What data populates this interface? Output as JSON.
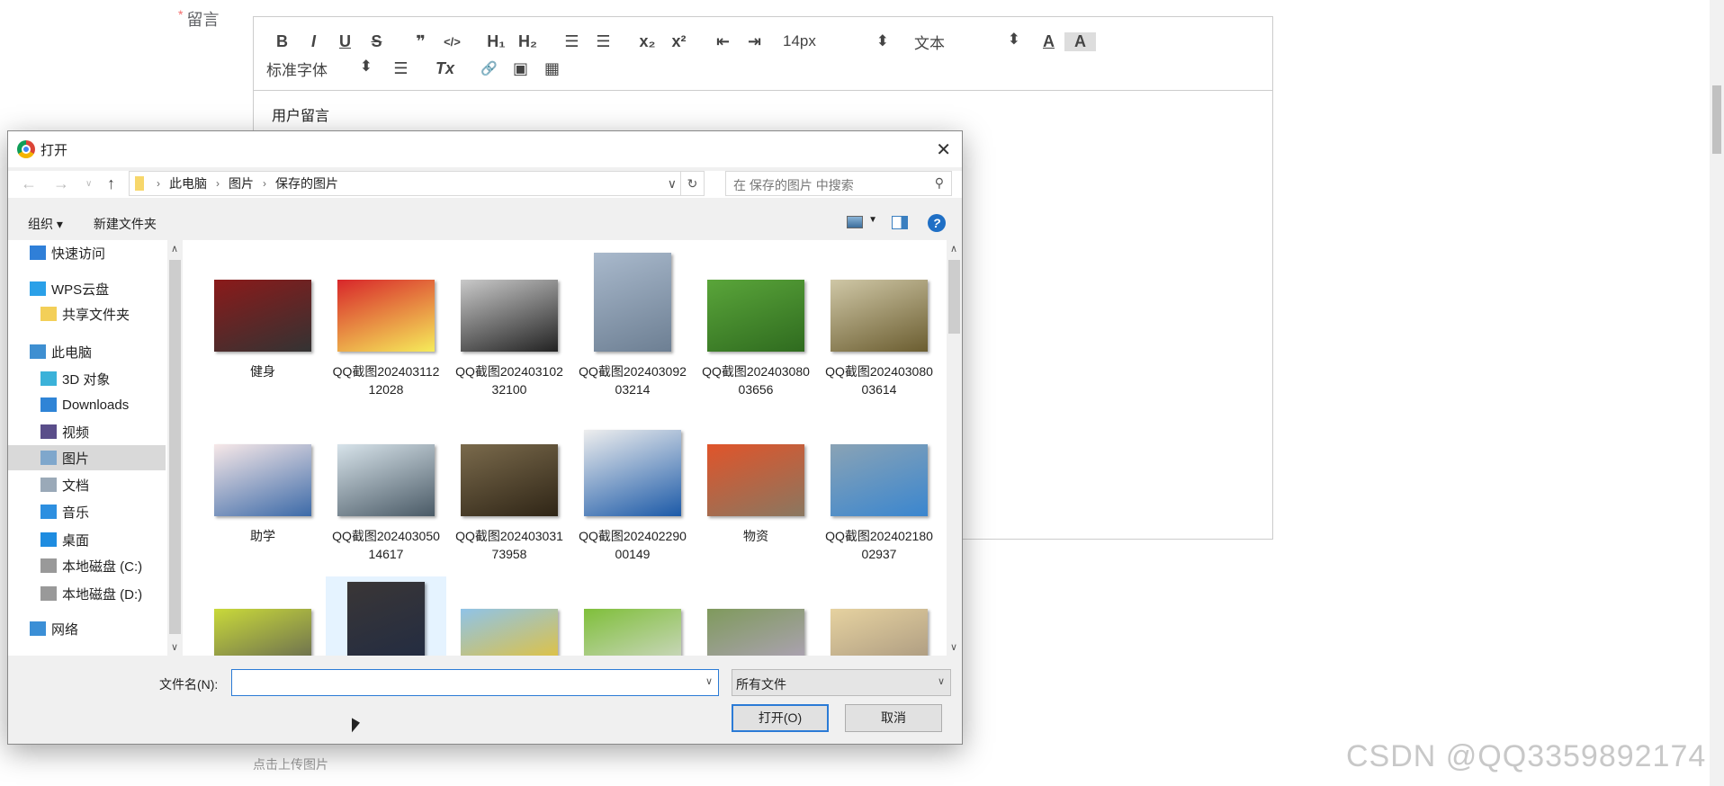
{
  "form": {
    "required_mark": "*",
    "field_label": "留言",
    "upload_hint": "点击上传图片"
  },
  "editor": {
    "toolbar": {
      "bold": "B",
      "italic": "I",
      "underline": "U",
      "strike": "S",
      "quote": "❞",
      "code": "</>",
      "h1": "H₁",
      "h2": "H₂",
      "ordered_list": "☰",
      "bullet_list": "☰",
      "subscript": "x₂",
      "superscript": "x²",
      "outdent": "⇤",
      "indent": "⇥",
      "font_size": "14px",
      "paragraph": "文本",
      "font_color": "A",
      "background": "A",
      "font_family": "标准字体",
      "align": "☰",
      "clean": "Tx",
      "link": "🔗",
      "image": "▣",
      "video": "▦"
    },
    "content": "用户留言"
  },
  "watermark": "CSDN @QQ3359892174",
  "dialog": {
    "title": "打开",
    "close": "✕",
    "breadcrumb": [
      "此电脑",
      "图片",
      "保存的图片"
    ],
    "search_placeholder": "在 保存的图片 中搜索",
    "organize": "组织 ▾",
    "new_folder": "新建文件夹",
    "help": "?",
    "nav": [
      {
        "label": "快速访问",
        "icon": "star-icon",
        "color": "#2f7fd8"
      },
      {
        "label": "WPS云盘",
        "icon": "cloud-icon",
        "color": "#2aa0e8"
      },
      {
        "label": "共享文件夹",
        "icon": "shared-folder-icon",
        "color": "#f3cf58"
      },
      {
        "label": "此电脑",
        "icon": "computer-icon",
        "color": "#3e8fd1"
      },
      {
        "label": "3D 对象",
        "icon": "cube-icon",
        "color": "#3bb2d9"
      },
      {
        "label": "Downloads",
        "icon": "download-arrow-icon",
        "color": "#2f84d6"
      },
      {
        "label": "视频",
        "icon": "film-icon",
        "color": "#5a4e8a"
      },
      {
        "label": "图片",
        "icon": "picture-icon",
        "color": "#7fa7cc",
        "selected": true
      },
      {
        "label": "文档",
        "icon": "document-icon",
        "color": "#9aa9b8"
      },
      {
        "label": "音乐",
        "icon": "music-note-icon",
        "color": "#2d8fe0"
      },
      {
        "label": "桌面",
        "icon": "desktop-icon",
        "color": "#1e8ce0"
      },
      {
        "label": "本地磁盘 (C:)",
        "icon": "drive-icon",
        "color": "#999"
      },
      {
        "label": "本地磁盘 (D:)",
        "icon": "drive-icon",
        "color": "#999"
      },
      {
        "label": "网络",
        "icon": "network-icon",
        "color": "#3b8fd6"
      }
    ],
    "files": [
      {
        "label": "健身",
        "thumb": [
          "#8b1a1a",
          "#333"
        ],
        "orientation": "landscape"
      },
      {
        "label": "QQ截图20240311212028",
        "thumb": [
          "#d8262a",
          "#f6ec5a"
        ],
        "orientation": "landscape"
      },
      {
        "label": "QQ截图20240310232100",
        "thumb": [
          "#c9c9c9",
          "#222"
        ],
        "orientation": "landscape"
      },
      {
        "label": "QQ截图20240309203214",
        "thumb": [
          "#a9b9cc",
          "#6d7f93"
        ],
        "orientation": "portrait"
      },
      {
        "label": "QQ截图20240308003656",
        "thumb": [
          "#5aa53a",
          "#2f6b1f"
        ],
        "orientation": "landscape"
      },
      {
        "label": "QQ截图20240308003614",
        "thumb": [
          "#cfc7a6",
          "#6b5d30"
        ],
        "orientation": "landscape"
      },
      {
        "label": "助学",
        "thumb": [
          "#f7e8e8",
          "#3c6aa8"
        ],
        "orientation": "landscape"
      },
      {
        "label": "QQ截图20240305014617",
        "thumb": [
          "#d7e3ea",
          "#4a5a66"
        ],
        "orientation": "landscape"
      },
      {
        "label": "QQ截图20240303173958",
        "thumb": [
          "#7a6a4c",
          "#2f2516"
        ],
        "orientation": "landscape"
      },
      {
        "label": "QQ截图20240229000149",
        "thumb": [
          "#eeeeee",
          "#1c5aa8"
        ],
        "orientation": "square"
      },
      {
        "label": "物资",
        "thumb": [
          "#e0542a",
          "#8a7760"
        ],
        "orientation": "landscape"
      },
      {
        "label": "QQ截图20240218002937",
        "thumb": [
          "#8aa3b5",
          "#3a86cf"
        ],
        "orientation": "landscape"
      },
      {
        "label": "",
        "thumb": [
          "#c9d93a",
          "#555"
        ],
        "orientation": "landscape"
      },
      {
        "label": "",
        "thumb": [
          "#3a3636",
          "#1e2a44"
        ],
        "orientation": "portrait"
      },
      {
        "label": "",
        "thumb": [
          "#8fc3e8",
          "#f3c21a"
        ],
        "orientation": "landscape"
      },
      {
        "label": "",
        "thumb": [
          "#7fbf3a",
          "#dcdcdc"
        ],
        "orientation": "landscape"
      },
      {
        "label": "",
        "thumb": [
          "#7f9a5c",
          "#b7a4c8"
        ],
        "orientation": "landscape"
      },
      {
        "label": "",
        "thumb": [
          "#e6d2a0",
          "#a08f7a"
        ],
        "orientation": "landscape"
      }
    ],
    "filename_label": "文件名(N):",
    "filename_value": "",
    "filetype": "所有文件",
    "open_button": "打开(O)",
    "cancel_button": "取消"
  }
}
